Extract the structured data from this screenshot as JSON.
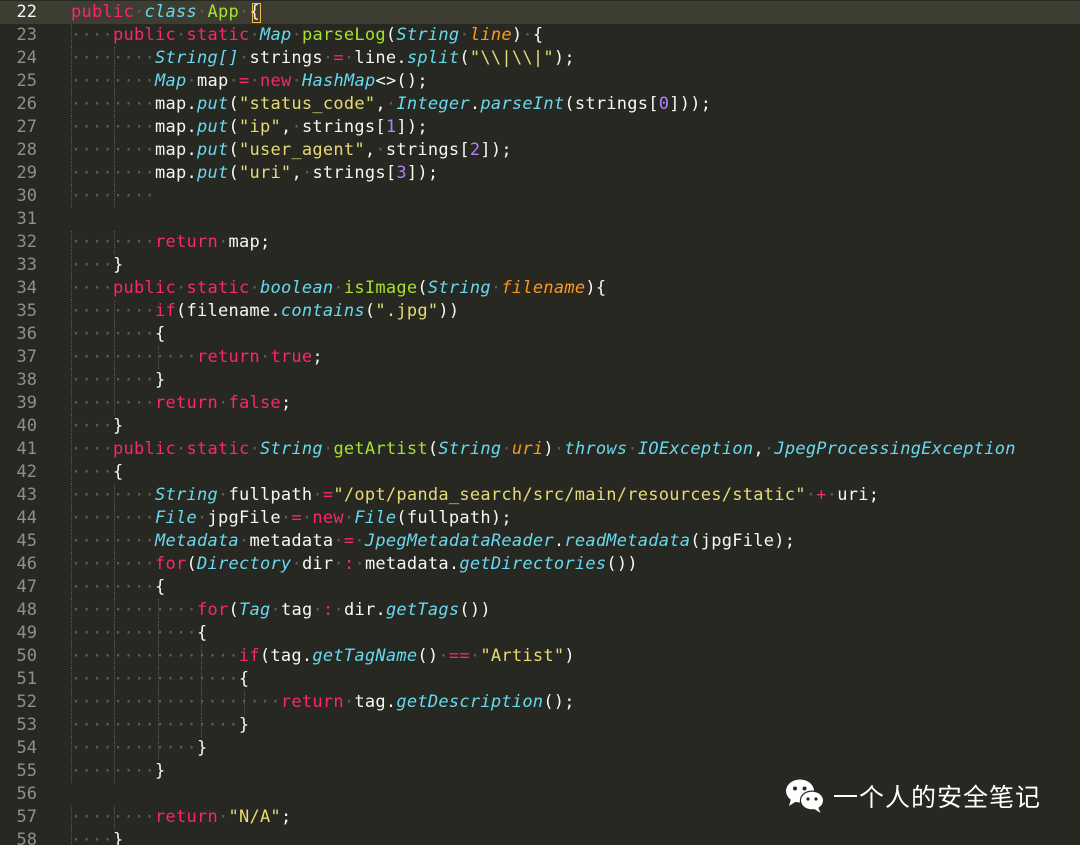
{
  "editor": {
    "current_line": "22",
    "lines": [
      {
        "n": "22",
        "indent": 0,
        "tokens": [
          [
            "kw",
            "public"
          ],
          [
            "ws",
            "·"
          ],
          [
            "type",
            "class"
          ],
          [
            "ws",
            "·"
          ],
          [
            "fn",
            "App"
          ],
          [
            "ws",
            "·"
          ],
          [
            "plain",
            "{"
          ]
        ]
      },
      {
        "n": "23",
        "indent": 1,
        "tokens": [
          [
            "kw",
            "public"
          ],
          [
            "ws",
            "·"
          ],
          [
            "kw",
            "static"
          ],
          [
            "ws",
            "·"
          ],
          [
            "type",
            "Map"
          ],
          [
            "ws",
            "·"
          ],
          [
            "fn",
            "parseLog"
          ],
          [
            "plain",
            "("
          ],
          [
            "type",
            "String"
          ],
          [
            "ws",
            "·"
          ],
          [
            "param",
            "line"
          ],
          [
            "plain",
            ")"
          ],
          [
            "ws",
            "·"
          ],
          [
            "plain",
            "{"
          ]
        ]
      },
      {
        "n": "24",
        "indent": 2,
        "tokens": [
          [
            "type",
            "String[]"
          ],
          [
            "ws",
            "·"
          ],
          [
            "plain",
            "strings"
          ],
          [
            "ws",
            "·"
          ],
          [
            "kw",
            "="
          ],
          [
            "ws",
            "·"
          ],
          [
            "plain",
            "line."
          ],
          [
            "type",
            "split"
          ],
          [
            "plain",
            "("
          ],
          [
            "str",
            "\"\\\\|\\\\|\""
          ],
          [
            "plain",
            ");"
          ]
        ]
      },
      {
        "n": "25",
        "indent": 2,
        "tokens": [
          [
            "type",
            "Map"
          ],
          [
            "ws",
            "·"
          ],
          [
            "plain",
            "map"
          ],
          [
            "ws",
            "·"
          ],
          [
            "kw",
            "="
          ],
          [
            "ws",
            "·"
          ],
          [
            "kw",
            "new"
          ],
          [
            "ws",
            "·"
          ],
          [
            "type",
            "HashMap"
          ],
          [
            "plain",
            "<>();"
          ]
        ]
      },
      {
        "n": "26",
        "indent": 2,
        "tokens": [
          [
            "plain",
            "map."
          ],
          [
            "type",
            "put"
          ],
          [
            "plain",
            "("
          ],
          [
            "str",
            "\"status_code\""
          ],
          [
            "plain",
            ","
          ],
          [
            "ws",
            "·"
          ],
          [
            "type",
            "Integer"
          ],
          [
            "plain",
            "."
          ],
          [
            "type",
            "parseInt"
          ],
          [
            "plain",
            "(strings["
          ],
          [
            "num",
            "0"
          ],
          [
            "plain",
            "]));"
          ]
        ]
      },
      {
        "n": "27",
        "indent": 2,
        "tokens": [
          [
            "plain",
            "map."
          ],
          [
            "type",
            "put"
          ],
          [
            "plain",
            "("
          ],
          [
            "str",
            "\"ip\""
          ],
          [
            "plain",
            ","
          ],
          [
            "ws",
            "·"
          ],
          [
            "plain",
            "strings["
          ],
          [
            "num",
            "1"
          ],
          [
            "plain",
            "]);"
          ]
        ]
      },
      {
        "n": "28",
        "indent": 2,
        "tokens": [
          [
            "plain",
            "map."
          ],
          [
            "type",
            "put"
          ],
          [
            "plain",
            "("
          ],
          [
            "str",
            "\"user_agent\""
          ],
          [
            "plain",
            ","
          ],
          [
            "ws",
            "·"
          ],
          [
            "plain",
            "strings["
          ],
          [
            "num",
            "2"
          ],
          [
            "plain",
            "]);"
          ]
        ]
      },
      {
        "n": "29",
        "indent": 2,
        "tokens": [
          [
            "plain",
            "map."
          ],
          [
            "type",
            "put"
          ],
          [
            "plain",
            "("
          ],
          [
            "str",
            "\"uri\""
          ],
          [
            "plain",
            ","
          ],
          [
            "ws",
            "·"
          ],
          [
            "plain",
            "strings["
          ],
          [
            "num",
            "3"
          ],
          [
            "plain",
            "]);"
          ]
        ]
      },
      {
        "n": "30",
        "indent": 2,
        "tokens": []
      },
      {
        "n": "31",
        "indent": 0,
        "tokens": []
      },
      {
        "n": "32",
        "indent": 2,
        "tokens": [
          [
            "kw",
            "return"
          ],
          [
            "ws",
            "·"
          ],
          [
            "plain",
            "map;"
          ]
        ]
      },
      {
        "n": "33",
        "indent": 1,
        "tokens": [
          [
            "plain",
            "}"
          ]
        ]
      },
      {
        "n": "34",
        "indent": 1,
        "tokens": [
          [
            "kw",
            "public"
          ],
          [
            "ws",
            "·"
          ],
          [
            "kw",
            "static"
          ],
          [
            "ws",
            "·"
          ],
          [
            "type",
            "boolean"
          ],
          [
            "ws",
            "·"
          ],
          [
            "fn",
            "isImage"
          ],
          [
            "plain",
            "("
          ],
          [
            "type",
            "String"
          ],
          [
            "ws",
            "·"
          ],
          [
            "param",
            "filename"
          ],
          [
            "plain",
            "){"
          ]
        ]
      },
      {
        "n": "35",
        "indent": 2,
        "tokens": [
          [
            "kw",
            "if"
          ],
          [
            "plain",
            "(filename."
          ],
          [
            "type",
            "contains"
          ],
          [
            "plain",
            "("
          ],
          [
            "str",
            "\".jpg\""
          ],
          [
            "plain",
            "))"
          ]
        ]
      },
      {
        "n": "36",
        "indent": 2,
        "tokens": [
          [
            "plain",
            "{"
          ]
        ]
      },
      {
        "n": "37",
        "indent": 3,
        "tokens": [
          [
            "kw",
            "return"
          ],
          [
            "ws",
            "·"
          ],
          [
            "kw",
            "true"
          ],
          [
            "plain",
            ";"
          ]
        ]
      },
      {
        "n": "38",
        "indent": 2,
        "tokens": [
          [
            "plain",
            "}"
          ]
        ]
      },
      {
        "n": "39",
        "indent": 2,
        "tokens": [
          [
            "kw",
            "return"
          ],
          [
            "ws",
            "·"
          ],
          [
            "kw",
            "false"
          ],
          [
            "plain",
            ";"
          ]
        ]
      },
      {
        "n": "40",
        "indent": 1,
        "tokens": [
          [
            "plain",
            "}"
          ]
        ]
      },
      {
        "n": "41",
        "indent": 1,
        "tokens": [
          [
            "kw",
            "public"
          ],
          [
            "ws",
            "·"
          ],
          [
            "kw",
            "static"
          ],
          [
            "ws",
            "·"
          ],
          [
            "type",
            "String"
          ],
          [
            "ws",
            "·"
          ],
          [
            "fn",
            "getArtist"
          ],
          [
            "plain",
            "("
          ],
          [
            "type",
            "String"
          ],
          [
            "ws",
            "·"
          ],
          [
            "param",
            "uri"
          ],
          [
            "plain",
            ")"
          ],
          [
            "ws",
            "·"
          ],
          [
            "type",
            "throws"
          ],
          [
            "ws",
            "·"
          ],
          [
            "type",
            "IOException"
          ],
          [
            "plain",
            ","
          ],
          [
            "ws",
            "·"
          ],
          [
            "type",
            "JpegProcessingException"
          ]
        ]
      },
      {
        "n": "42",
        "indent": 1,
        "tokens": [
          [
            "plain",
            "{"
          ]
        ]
      },
      {
        "n": "43",
        "indent": 2,
        "tokens": [
          [
            "type",
            "String"
          ],
          [
            "ws",
            "·"
          ],
          [
            "plain",
            "fullpath"
          ],
          [
            "ws",
            "·"
          ],
          [
            "kw",
            "="
          ],
          [
            "str",
            "\"/opt/panda_search/src/main/resources/static\""
          ],
          [
            "ws",
            "·"
          ],
          [
            "kw",
            "+"
          ],
          [
            "ws",
            "·"
          ],
          [
            "plain",
            "uri;"
          ]
        ]
      },
      {
        "n": "44",
        "indent": 2,
        "tokens": [
          [
            "type",
            "File"
          ],
          [
            "ws",
            "·"
          ],
          [
            "plain",
            "jpgFile"
          ],
          [
            "ws",
            "·"
          ],
          [
            "kw",
            "="
          ],
          [
            "ws",
            "·"
          ],
          [
            "kw",
            "new"
          ],
          [
            "ws",
            "·"
          ],
          [
            "type",
            "File"
          ],
          [
            "plain",
            "(fullpath);"
          ]
        ]
      },
      {
        "n": "45",
        "indent": 2,
        "tokens": [
          [
            "type",
            "Metadata"
          ],
          [
            "ws",
            "·"
          ],
          [
            "plain",
            "metadata"
          ],
          [
            "ws",
            "·"
          ],
          [
            "kw",
            "="
          ],
          [
            "ws",
            "·"
          ],
          [
            "type",
            "JpegMetadataReader"
          ],
          [
            "plain",
            "."
          ],
          [
            "type",
            "readMetadata"
          ],
          [
            "plain",
            "(jpgFile);"
          ]
        ]
      },
      {
        "n": "46",
        "indent": 2,
        "tokens": [
          [
            "kw",
            "for"
          ],
          [
            "plain",
            "("
          ],
          [
            "type",
            "Directory"
          ],
          [
            "ws",
            "·"
          ],
          [
            "plain",
            "dir"
          ],
          [
            "ws",
            "·"
          ],
          [
            "kw",
            ":"
          ],
          [
            "ws",
            "·"
          ],
          [
            "plain",
            "metadata."
          ],
          [
            "type",
            "getDirectories"
          ],
          [
            "plain",
            "())"
          ]
        ]
      },
      {
        "n": "47",
        "indent": 2,
        "tokens": [
          [
            "plain",
            "{"
          ]
        ]
      },
      {
        "n": "48",
        "indent": 3,
        "tokens": [
          [
            "kw",
            "for"
          ],
          [
            "plain",
            "("
          ],
          [
            "type",
            "Tag"
          ],
          [
            "ws",
            "·"
          ],
          [
            "plain",
            "tag"
          ],
          [
            "ws",
            "·"
          ],
          [
            "kw",
            ":"
          ],
          [
            "ws",
            "·"
          ],
          [
            "plain",
            "dir."
          ],
          [
            "type",
            "getTags"
          ],
          [
            "plain",
            "())"
          ]
        ]
      },
      {
        "n": "49",
        "indent": 3,
        "tokens": [
          [
            "plain",
            "{"
          ]
        ]
      },
      {
        "n": "50",
        "indent": 4,
        "tokens": [
          [
            "kw",
            "if"
          ],
          [
            "plain",
            "(tag."
          ],
          [
            "type",
            "getTagName"
          ],
          [
            "plain",
            "()"
          ],
          [
            "ws",
            "·"
          ],
          [
            "kw",
            "=="
          ],
          [
            "ws",
            "·"
          ],
          [
            "str",
            "\"Artist\""
          ],
          [
            "plain",
            ")"
          ]
        ]
      },
      {
        "n": "51",
        "indent": 4,
        "tokens": [
          [
            "plain",
            "{"
          ]
        ]
      },
      {
        "n": "52",
        "indent": 5,
        "tokens": [
          [
            "kw",
            "return"
          ],
          [
            "ws",
            "·"
          ],
          [
            "plain",
            "tag."
          ],
          [
            "type",
            "getDescription"
          ],
          [
            "plain",
            "();"
          ]
        ]
      },
      {
        "n": "53",
        "indent": 4,
        "tokens": [
          [
            "plain",
            "}"
          ]
        ]
      },
      {
        "n": "54",
        "indent": 3,
        "tokens": [
          [
            "plain",
            "}"
          ]
        ]
      },
      {
        "n": "55",
        "indent": 2,
        "tokens": [
          [
            "plain",
            "}"
          ]
        ]
      },
      {
        "n": "56",
        "indent": 0,
        "tokens": []
      },
      {
        "n": "57",
        "indent": 2,
        "tokens": [
          [
            "kw",
            "return"
          ],
          [
            "ws",
            "·"
          ],
          [
            "str",
            "\"N/A\""
          ],
          [
            "plain",
            ";"
          ]
        ]
      },
      {
        "n": "58",
        "indent": 1,
        "tokens": [
          [
            "plain",
            "}"
          ]
        ]
      }
    ]
  },
  "watermark": {
    "text": "一个人的安全笔记",
    "icon": "wechat-icon"
  },
  "colors": {
    "background": "#272822",
    "current_line": "#3e3d32",
    "line_number": "#90908a",
    "whitespace_marker": "#5e5d56",
    "keyword": "#f92672",
    "type": "#66d9ef",
    "function": "#a6e22e",
    "parameter": "#fd971f",
    "string": "#e6db74",
    "number": "#ae81ff",
    "cursor": "#f8bc45"
  }
}
